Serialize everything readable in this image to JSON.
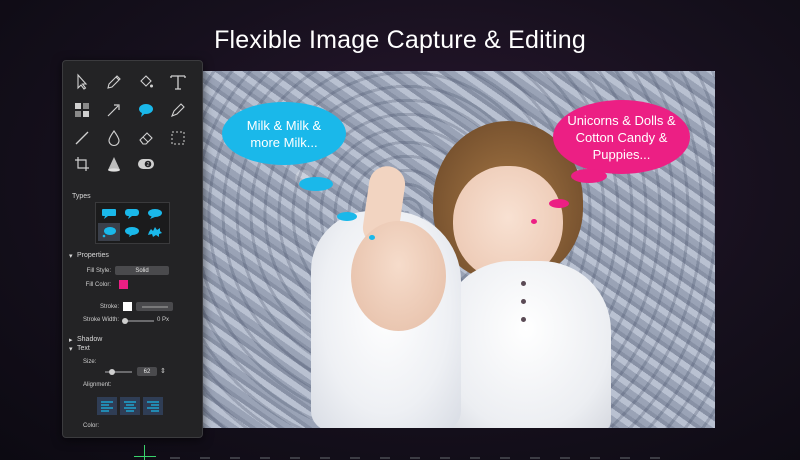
{
  "headline": "Flexible Image Capture & Editing",
  "canvas": {
    "bubble_left": [
      "Milk & Milk &",
      "more Milk..."
    ],
    "bubble_right": [
      "Unicorns & Dolls &",
      "Cotton Candy &",
      "Puppies..."
    ],
    "colors": {
      "blue": "#1ab8ea",
      "pink": "#ec1f84"
    }
  },
  "panel": {
    "tools": [
      "arrow-select-icon",
      "pencil-icon",
      "fill-bucket-icon",
      "text-tool-icon",
      "pixelate-icon",
      "arrow-icon",
      "speech-bubble-icon",
      "pen-icon",
      "line-icon",
      "drop-icon",
      "eraser-icon",
      "marquee-select-icon",
      "crop-icon",
      "spotlight-icon",
      "counter-icon"
    ],
    "types_label": "Types",
    "properties_label": "Properties",
    "fill_style_label": "Fill Style:",
    "fill_style_value": "Solid",
    "fill_color_label": "Fill Color:",
    "fill_color": "#ec1f84",
    "stroke_label": "Stroke:",
    "stroke_width_label": "Stroke Width:",
    "stroke_width_value": "0 Px",
    "shadow_label": "Shadow",
    "text_label": "Text",
    "size_label": "Size:",
    "size_value": "62",
    "alignment_label": "Alignment:",
    "color_label": "Color:"
  }
}
